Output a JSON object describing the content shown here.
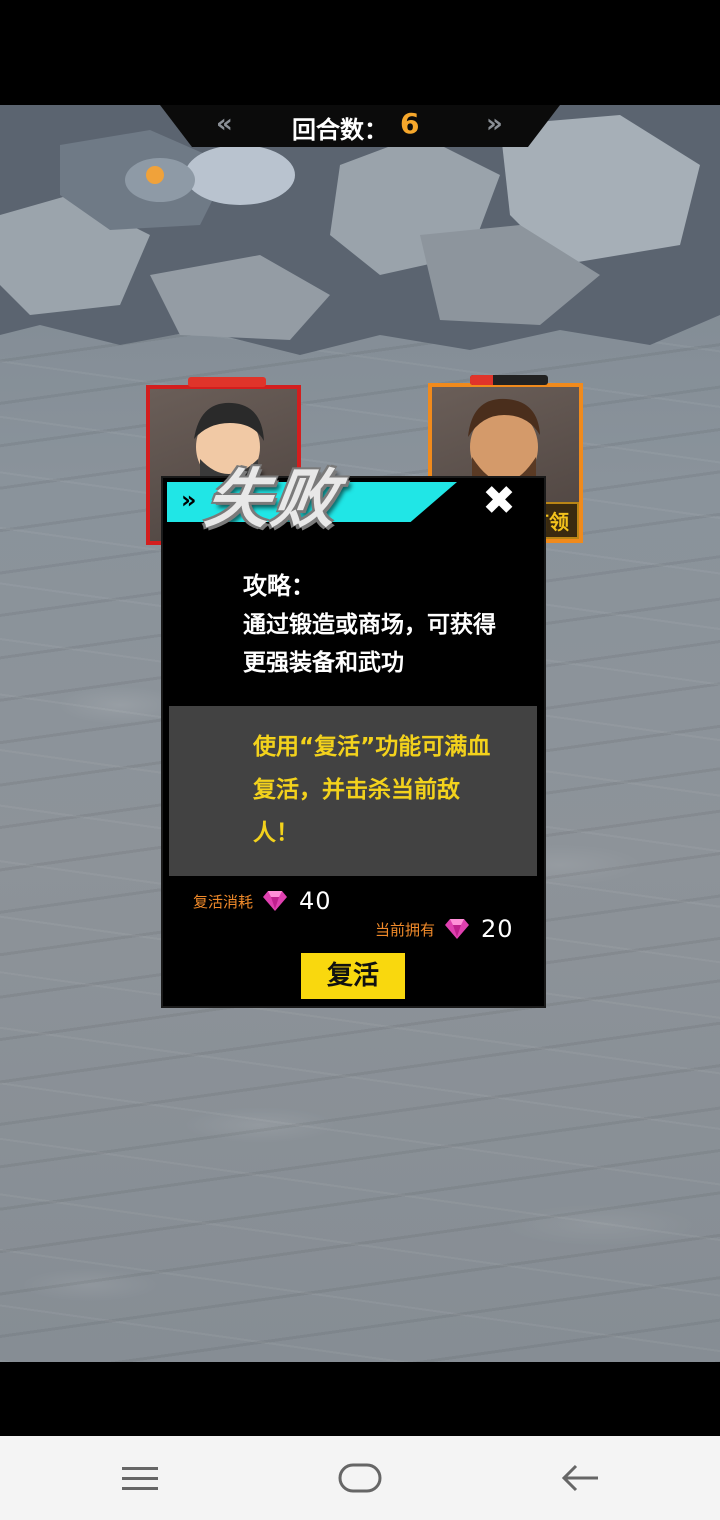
{
  "hud": {
    "round_label": "回合数：",
    "round_value": "6",
    "left_arrow": "«",
    "right_arrow": "»"
  },
  "portraits": {
    "player": {
      "hp_fraction": 1.0
    },
    "enemy": {
      "hp_fraction": 0.3,
      "tag": "首领"
    }
  },
  "dialog": {
    "title": "失败",
    "banner_chevron": "»",
    "close_symbol": "✖",
    "tip_heading": "攻略：",
    "tip_body": "通过锻造或商场，可获得更强装备和武功",
    "revive_info": "使用“复活”功能可满血复活，并击杀当前敌人！",
    "cost_label": "复活消耗",
    "cost_value": "40",
    "owned_label": "当前拥有",
    "owned_value": "20",
    "revive_button": "复活"
  },
  "colors": {
    "accent_cyan": "#20e6e6",
    "revive_yellow": "#f9d80e",
    "round_orange": "#f6a72b",
    "gem_pink": "#e040b0"
  },
  "icons": {
    "gem": "gem-icon",
    "close": "close-icon",
    "nav_menu": "menu-icon",
    "nav_home": "home-icon",
    "nav_back": "back-icon"
  }
}
